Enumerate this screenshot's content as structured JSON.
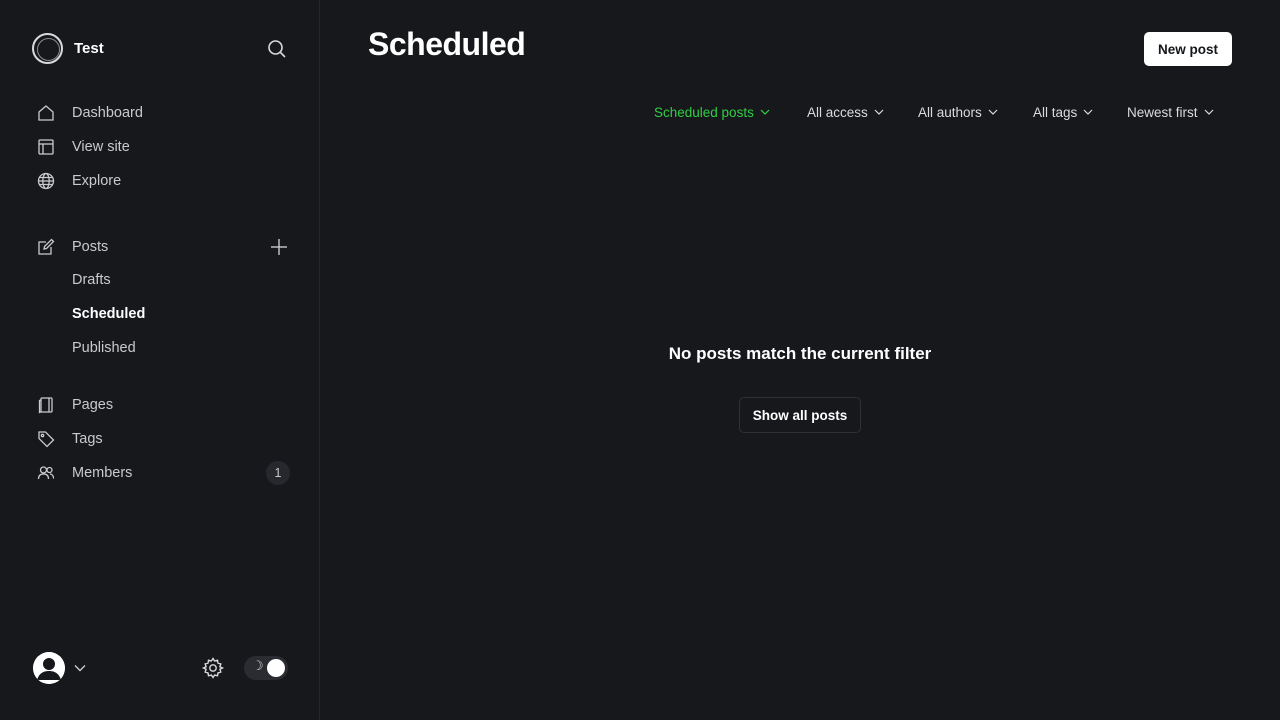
{
  "brand": {
    "name": "Test"
  },
  "sidebar": {
    "main": [
      {
        "label": "Dashboard",
        "icon": "home-icon"
      },
      {
        "label": "View site",
        "icon": "layout-icon"
      },
      {
        "label": "Explore",
        "icon": "globe-icon"
      }
    ],
    "posts": {
      "label": "Posts",
      "sub": [
        {
          "label": "Drafts",
          "active": false
        },
        {
          "label": "Scheduled",
          "active": true
        },
        {
          "label": "Published",
          "active": false
        }
      ]
    },
    "secondary": [
      {
        "label": "Pages",
        "icon": "page-icon"
      },
      {
        "label": "Tags",
        "icon": "tag-icon"
      },
      {
        "label": "Members",
        "icon": "members-icon",
        "badge": "1"
      }
    ]
  },
  "header": {
    "title": "Scheduled",
    "new_post_label": "New post"
  },
  "filters": [
    {
      "label": "Scheduled posts",
      "active": true
    },
    {
      "label": "All access",
      "active": false
    },
    {
      "label": "All authors",
      "active": false
    },
    {
      "label": "All tags",
      "active": false
    },
    {
      "label": "Newest first",
      "active": false
    }
  ],
  "empty_state": {
    "title": "No posts match the current filter",
    "button_label": "Show all posts"
  },
  "colors": {
    "background": "#17181c",
    "accent_green": "#30cf43",
    "text": "#e6e7e9"
  }
}
